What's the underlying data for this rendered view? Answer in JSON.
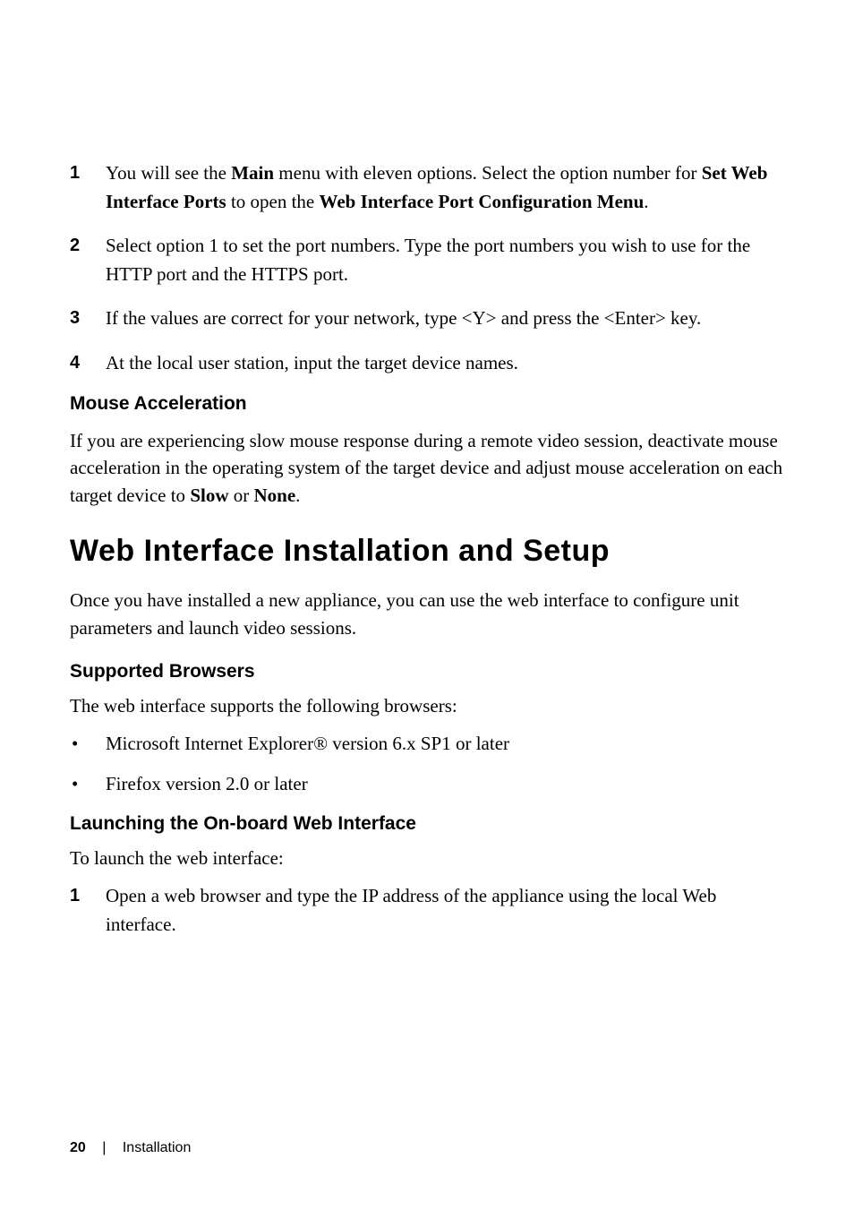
{
  "steps_top": [
    {
      "num": "1",
      "parts": [
        {
          "text": "You will see the ",
          "bold": false
        },
        {
          "text": "Main",
          "bold": true
        },
        {
          "text": " menu with eleven options. Select the option number for ",
          "bold": false
        },
        {
          "text": "Set Web Interface Ports",
          "bold": true
        },
        {
          "text": " to open the ",
          "bold": false
        },
        {
          "text": "Web Interface Port Configuration Menu",
          "bold": true
        },
        {
          "text": ".",
          "bold": false
        }
      ]
    },
    {
      "num": "2",
      "parts": [
        {
          "text": "Select option 1 to set the port numbers. Type the port numbers you wish to use for the HTTP port and the HTTPS port.",
          "bold": false
        }
      ]
    },
    {
      "num": "3",
      "parts": [
        {
          "text": "If the values are correct for your network, type <Y> and press the <Enter> key.",
          "bold": false
        }
      ]
    },
    {
      "num": "4",
      "parts": [
        {
          "text": "At the local user station, input the target device names.",
          "bold": false
        }
      ]
    }
  ],
  "mouse_heading": "Mouse Acceleration",
  "mouse_para_parts": [
    {
      "text": "If you are experiencing slow mouse response during a remote video session, deactivate mouse acceleration in the operating system of the target device and adjust mouse acceleration on each target device to ",
      "bold": false
    },
    {
      "text": "Slow",
      "bold": true
    },
    {
      "text": " or ",
      "bold": false
    },
    {
      "text": "None",
      "bold": true
    },
    {
      "text": ".",
      "bold": false
    }
  ],
  "main_heading": "Web Interface Installation and Setup",
  "main_para": "Once you have installed a new appliance, you can use the web interface to configure unit parameters and launch video sessions.",
  "browsers_heading": "Supported Browsers",
  "browsers_intro": "The web interface supports the following browsers:",
  "browsers_list": [
    "Microsoft Internet Explorer® version 6.x SP1 or later",
    "Firefox version 2.0 or later"
  ],
  "launch_heading": "Launching the On-board Web Interface",
  "launch_intro": "To launch the web interface:",
  "launch_steps": [
    {
      "num": "1",
      "text": "Open a web browser and type the IP address of the appliance using the local Web interface."
    }
  ],
  "footer": {
    "page_num": "20",
    "section": "Installation"
  }
}
